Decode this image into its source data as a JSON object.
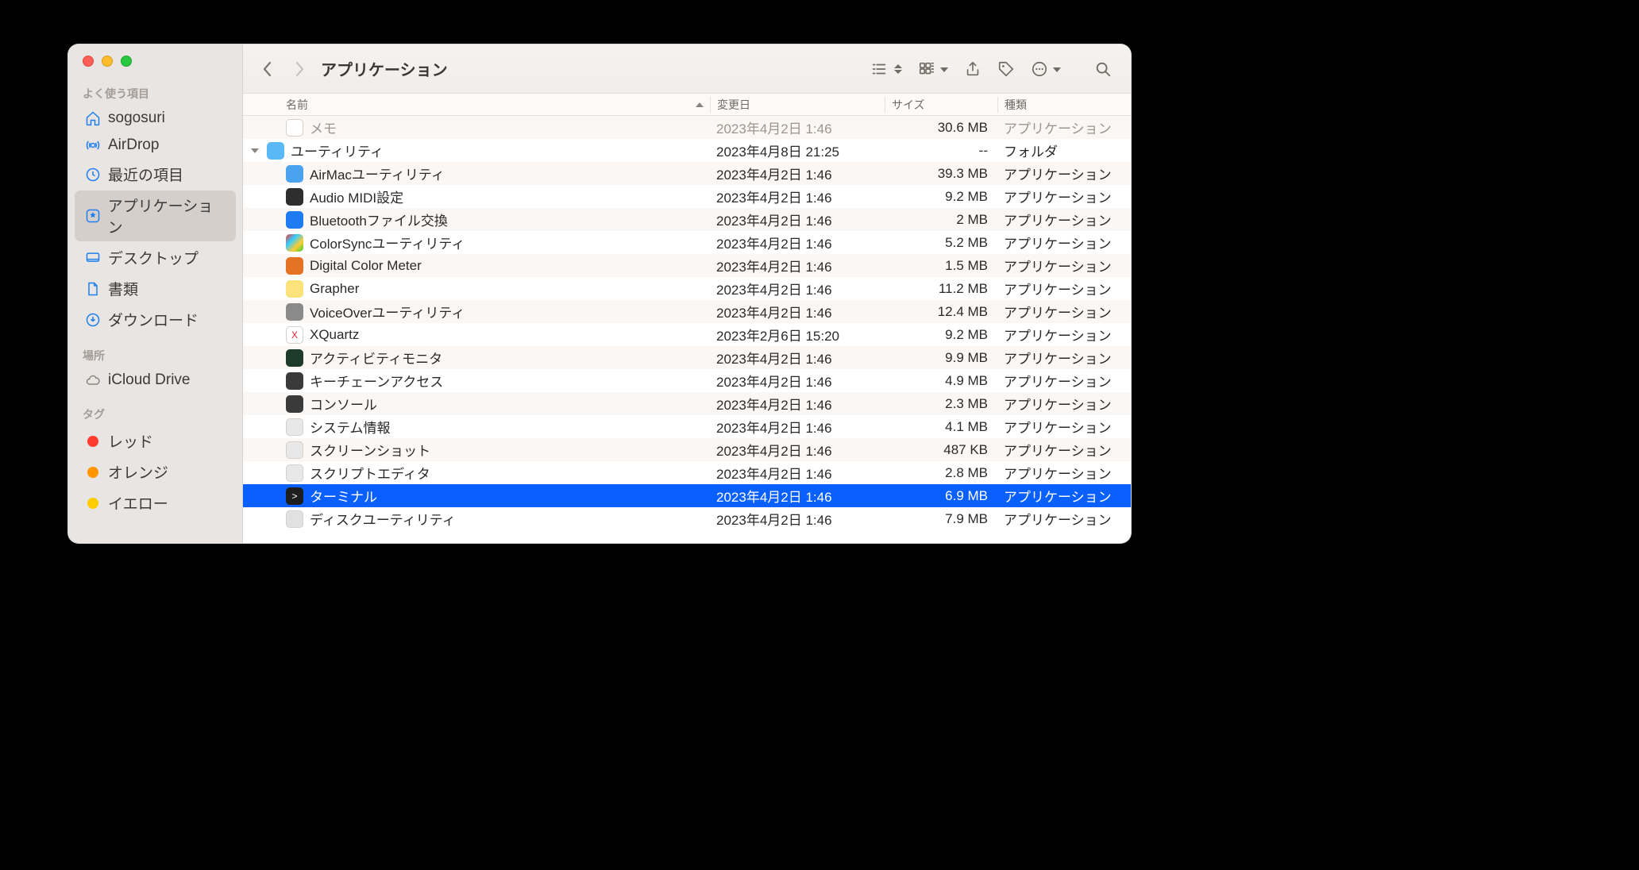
{
  "window": {
    "title": "アプリケーション"
  },
  "sidebar": {
    "sections": {
      "favorites": {
        "label": "よく使う項目",
        "items": [
          {
            "id": "home",
            "label": "sogosuri"
          },
          {
            "id": "airdrop",
            "label": "AirDrop"
          },
          {
            "id": "recents",
            "label": "最近の項目"
          },
          {
            "id": "applications",
            "label": "アプリケーション",
            "selected": true
          },
          {
            "id": "desktop",
            "label": "デスクトップ"
          },
          {
            "id": "documents",
            "label": "書類"
          },
          {
            "id": "downloads",
            "label": "ダウンロード"
          }
        ]
      },
      "locations": {
        "label": "場所",
        "items": [
          {
            "id": "icloud",
            "label": "iCloud Drive"
          }
        ]
      },
      "tags": {
        "label": "タグ",
        "items": [
          {
            "id": "red",
            "label": "レッド",
            "color": "#ff3b30"
          },
          {
            "id": "orange",
            "label": "オレンジ",
            "color": "#ff9500"
          },
          {
            "id": "yellow",
            "label": "イエロー",
            "color": "#ffcc00"
          }
        ]
      }
    }
  },
  "columns": {
    "name": "名前",
    "date": "変更日",
    "size": "サイズ",
    "kind": "種類"
  },
  "rows": [
    {
      "depth": 1,
      "name": "メモ",
      "date": "2023年4月2日 1:46",
      "size": "30.6 MB",
      "kind": "アプリケーション",
      "iconBg": "#fff",
      "iconText": "",
      "cut": true
    },
    {
      "depth": 0,
      "name": "ユーティリティ",
      "date": "2023年4月8日 21:25",
      "size": "--",
      "kind": "フォルダ",
      "iconBg": "#5ab8f7",
      "iconText": "",
      "disclosure": "open"
    },
    {
      "depth": 1,
      "name": "AirMacユーティリティ",
      "date": "2023年4月2日 1:46",
      "size": "39.3 MB",
      "kind": "アプリケーション",
      "iconBg": "#4aa3ef",
      "iconText": ""
    },
    {
      "depth": 1,
      "name": "Audio MIDI設定",
      "date": "2023年4月2日 1:46",
      "size": "9.2 MB",
      "kind": "アプリケーション",
      "iconBg": "#2e2e2e",
      "iconText": ""
    },
    {
      "depth": 1,
      "name": "Bluetoothファイル交換",
      "date": "2023年4月2日 1:46",
      "size": "2 MB",
      "kind": "アプリケーション",
      "iconBg": "#1e7bf0",
      "iconText": ""
    },
    {
      "depth": 1,
      "name": "ColorSyncユーティリティ",
      "date": "2023年4月2日 1:46",
      "size": "5.2 MB",
      "kind": "アプリケーション",
      "iconBg": "linear-gradient(135deg,#f33,#3cf,#fc3,#3c3)",
      "iconText": ""
    },
    {
      "depth": 1,
      "name": "Digital Color Meter",
      "date": "2023年4月2日 1:46",
      "size": "1.5 MB",
      "kind": "アプリケーション",
      "iconBg": "#e67324",
      "iconText": ""
    },
    {
      "depth": 1,
      "name": "Grapher",
      "date": "2023年4月2日 1:46",
      "size": "11.2 MB",
      "kind": "アプリケーション",
      "iconBg": "#fce27b",
      "iconText": ""
    },
    {
      "depth": 1,
      "name": "VoiceOverユーティリティ",
      "date": "2023年4月2日 1:46",
      "size": "12.4 MB",
      "kind": "アプリケーション",
      "iconBg": "#8a8a8a",
      "iconText": ""
    },
    {
      "depth": 1,
      "name": "XQuartz",
      "date": "2023年2月6日 15:20",
      "size": "9.2 MB",
      "kind": "アプリケーション",
      "iconBg": "#fff",
      "iconText": "X",
      "iconColor": "#d23"
    },
    {
      "depth": 1,
      "name": "アクティビティモニタ",
      "date": "2023年4月2日 1:46",
      "size": "9.9 MB",
      "kind": "アプリケーション",
      "iconBg": "#1d3a2a",
      "iconText": ""
    },
    {
      "depth": 1,
      "name": "キーチェーンアクセス",
      "date": "2023年4月2日 1:46",
      "size": "4.9 MB",
      "kind": "アプリケーション",
      "iconBg": "#3a3a3a",
      "iconText": ""
    },
    {
      "depth": 1,
      "name": "コンソール",
      "date": "2023年4月2日 1:46",
      "size": "2.3 MB",
      "kind": "アプリケーション",
      "iconBg": "#3a3a3a",
      "iconText": ""
    },
    {
      "depth": 1,
      "name": "システム情報",
      "date": "2023年4月2日 1:46",
      "size": "4.1 MB",
      "kind": "アプリケーション",
      "iconBg": "#e8e8e8",
      "iconText": ""
    },
    {
      "depth": 1,
      "name": "スクリーンショット",
      "date": "2023年4月2日 1:46",
      "size": "487 KB",
      "kind": "アプリケーション",
      "iconBg": "#e8e8e8",
      "iconText": ""
    },
    {
      "depth": 1,
      "name": "スクリプトエディタ",
      "date": "2023年4月2日 1:46",
      "size": "2.8 MB",
      "kind": "アプリケーション",
      "iconBg": "#e8e8e8",
      "iconText": ""
    },
    {
      "depth": 1,
      "name": "ターミナル",
      "date": "2023年4月2日 1:46",
      "size": "6.9 MB",
      "kind": "アプリケーション",
      "iconBg": "#1e1e1e",
      "iconText": ">",
      "selected": true
    },
    {
      "depth": 1,
      "name": "ディスクユーティリティ",
      "date": "2023年4月2日 1:46",
      "size": "7.9 MB",
      "kind": "アプリケーション",
      "iconBg": "#e1e1e1",
      "iconText": ""
    }
  ]
}
